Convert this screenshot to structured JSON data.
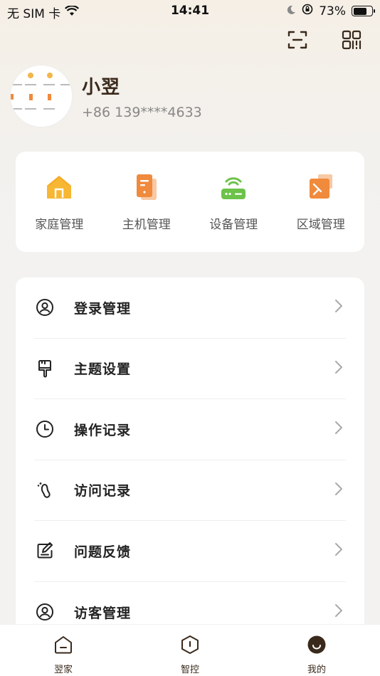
{
  "status_bar": {
    "carrier": "无 SIM 卡",
    "time": "14:41",
    "battery_text": "73%",
    "battery_level": 0.73
  },
  "profile": {
    "name": "小翌",
    "phone": "+86 139****4633"
  },
  "quick_actions": [
    {
      "label": "家庭管理",
      "icon": "home-icon"
    },
    {
      "label": "主机管理",
      "icon": "host-icon"
    },
    {
      "label": "设备管理",
      "icon": "router-icon"
    },
    {
      "label": "区域管理",
      "icon": "area-icon"
    }
  ],
  "menu": [
    {
      "label": "登录管理",
      "icon": "user-circle-icon"
    },
    {
      "label": "主题设置",
      "icon": "brush-icon"
    },
    {
      "label": "操作记录",
      "icon": "clock-icon"
    },
    {
      "label": "访问记录",
      "icon": "footprint-icon"
    },
    {
      "label": "问题反馈",
      "icon": "feedback-icon"
    },
    {
      "label": "访客管理",
      "icon": "visitor-icon"
    }
  ],
  "tabbar": [
    {
      "label": "翌家",
      "icon": "home-tab-icon"
    },
    {
      "label": "智控",
      "icon": "control-tab-icon"
    },
    {
      "label": "我的",
      "icon": "profile-tab-icon"
    }
  ],
  "colors": {
    "accent_orange": "#f08a3c",
    "home_yellow": "#f7b733",
    "router_green": "#6cc24a",
    "text_brown": "#3a2a1c"
  }
}
